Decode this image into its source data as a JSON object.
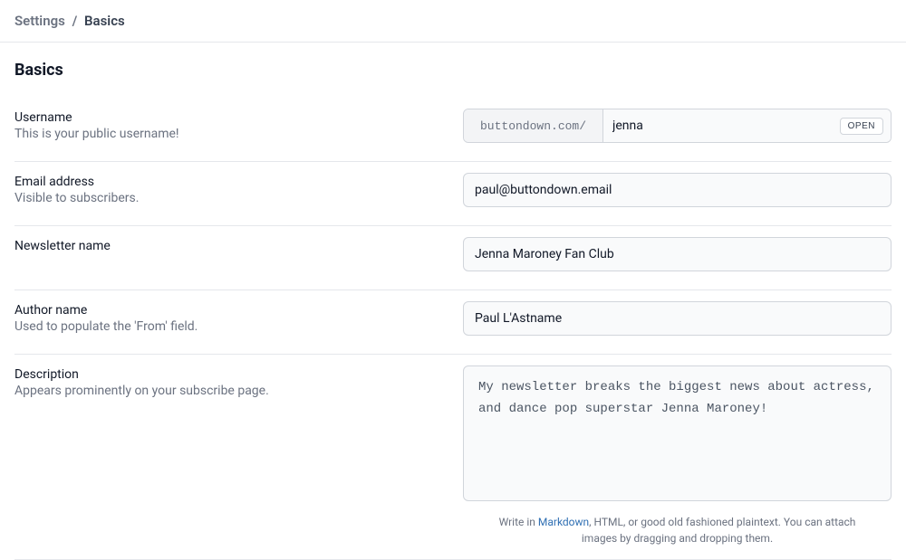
{
  "breadcrumb": {
    "parent": "Settings",
    "separator": "/",
    "current": "Basics"
  },
  "page_title": "Basics",
  "fields": {
    "username": {
      "label": "Username",
      "help": "This is your public username!",
      "prefix": "buttondown.com/",
      "value": "jenna",
      "open_label": "OPEN"
    },
    "email": {
      "label": "Email address",
      "help": "Visible to subscribers.",
      "value": "paul@buttondown.email"
    },
    "newsletter_name": {
      "label": "Newsletter name",
      "value": "Jenna Maroney Fan Club"
    },
    "author_name": {
      "label": "Author name",
      "help": "Used to populate the 'From' field.",
      "value": "Paul L'Astname"
    },
    "description": {
      "label": "Description",
      "help": "Appears prominently on your subscribe page.",
      "value": "My newsletter breaks the biggest news about actress, and dance pop superstar Jenna Maroney!",
      "hint_prefix": "Write in ",
      "hint_link": "Markdown",
      "hint_suffix": ", HTML, or good old fashioned plaintext. You can attach images by dragging and dropping them."
    }
  }
}
